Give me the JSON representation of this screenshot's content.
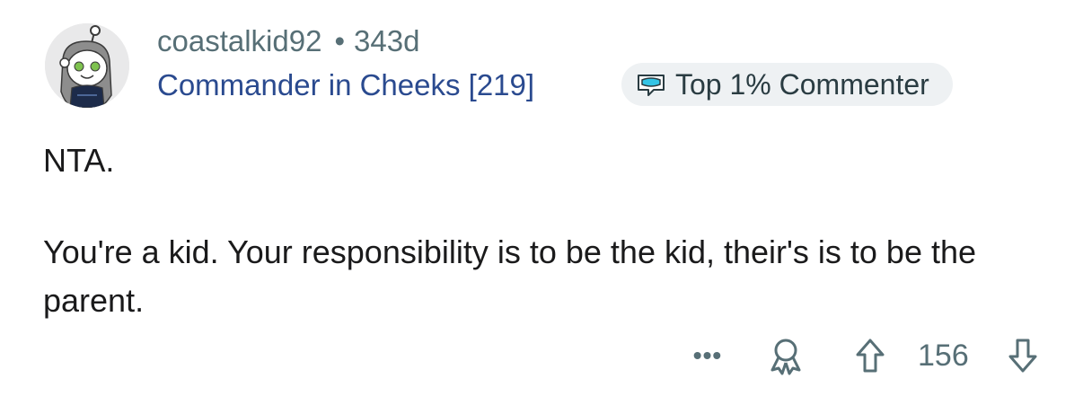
{
  "comment": {
    "username": "coastalkid92",
    "separator": "•",
    "age": "343d",
    "flair": "Commander in Cheeks [219]",
    "badge": {
      "icon": "commenter-badge-icon",
      "label": "Top 1% Commenter"
    },
    "body": [
      "NTA.",
      "You're a kid. Your responsibility is to be the kid, their's is to be the parent."
    ],
    "actions": {
      "more_label": "•••",
      "award_icon": "award-icon",
      "upvote_icon": "upvote-arrow-icon",
      "score": "156",
      "downvote_icon": "downvote-arrow-icon"
    }
  },
  "colors": {
    "meta": "#576f76",
    "flair": "#2a4a8f",
    "text": "#1a1a1b",
    "badge_bg": "#eef1f3"
  }
}
